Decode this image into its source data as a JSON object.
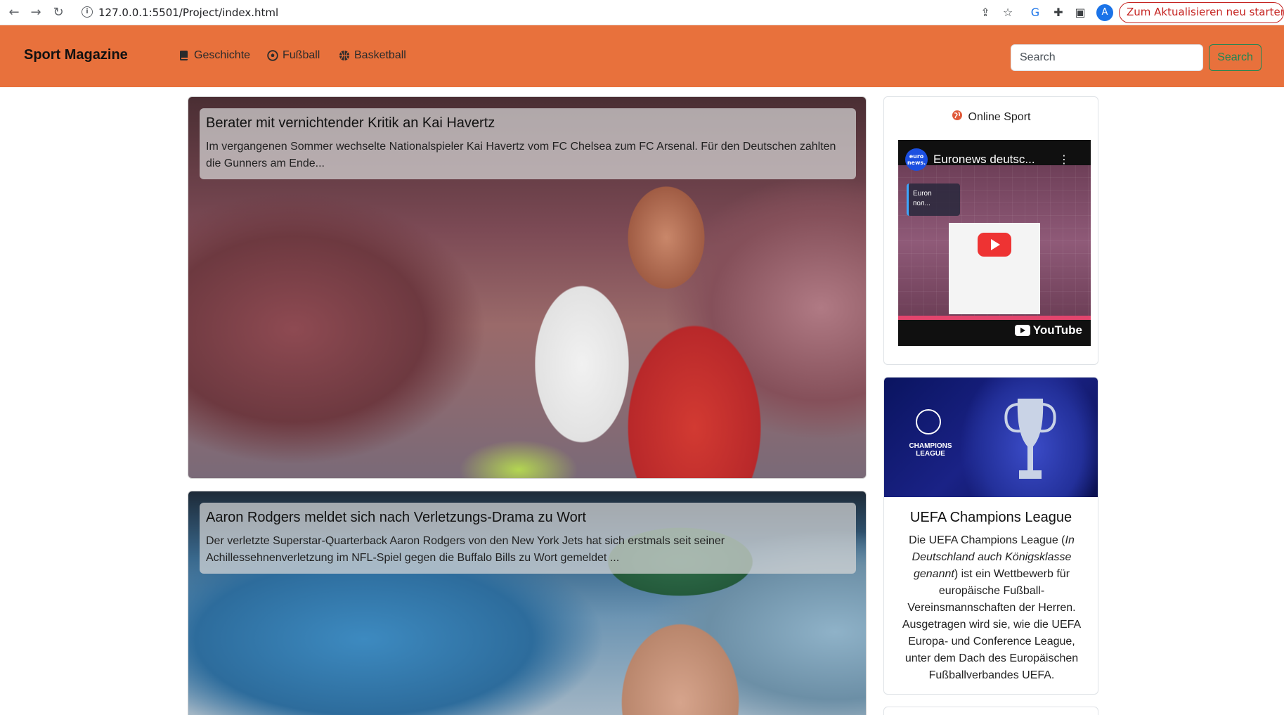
{
  "browser": {
    "url": "127.0.0.1:5501/Project/index.html",
    "update_button": "Zum Aktualisieren neu starten",
    "profile_initial": "A"
  },
  "navbar": {
    "brand": "Sport Magazine",
    "links": [
      {
        "label": "Geschichte",
        "icon": "book-icon"
      },
      {
        "label": "Fußball",
        "icon": "soccer-ball-icon"
      },
      {
        "label": "Basketball",
        "icon": "basketball-icon"
      }
    ],
    "search_placeholder": "Search",
    "search_button": "Search",
    "colors": {
      "navbar_bg": "#e8713c",
      "search_accent": "#198754"
    }
  },
  "articles": [
    {
      "title": "Berater mit vernichtender Kritik an Kai Havertz",
      "excerpt": "Im vergangenen Sommer wechselte Nationalspieler Kai Havertz vom FC Chelsea zum FC Arsenal. Für den Deutschen zahlten die Gunners am Ende..."
    },
    {
      "title": "Aaron Rodgers meldet sich nach Verletzungs-Drama zu Wort",
      "excerpt": "Der verletzte Superstar-Quarterback Aaron Rodgers von den New York Jets hat sich erstmals seit seiner Achillessehnenverletzung im NFL-Spiel gegen die Buffalo Bills zu Wort gemeldet ..."
    }
  ],
  "sidebar": {
    "video_card": {
      "title": "Online Sport",
      "video_title": "Euronews deutsc...",
      "channel_logo": "euro news.",
      "chip_line1": "Euron",
      "chip_line2": "пол...",
      "youtube_label": "YouTube"
    },
    "ucl_card": {
      "image_label": "CHAMPIONS LEAGUE",
      "title": "UEFA Champions League",
      "text_before": "Die UEFA Champions League (",
      "text_italic": "In Deutschland auch Königsklasse genannt",
      "text_after": ") ist ein Wettbewerb für europäische Fußball-Vereinsmannschaften der Herren. Ausgetragen wird sie, wie die UEFA Europa- und Conference League, unter dem Dach des Europäischen Fußballverbandes UEFA."
    }
  }
}
